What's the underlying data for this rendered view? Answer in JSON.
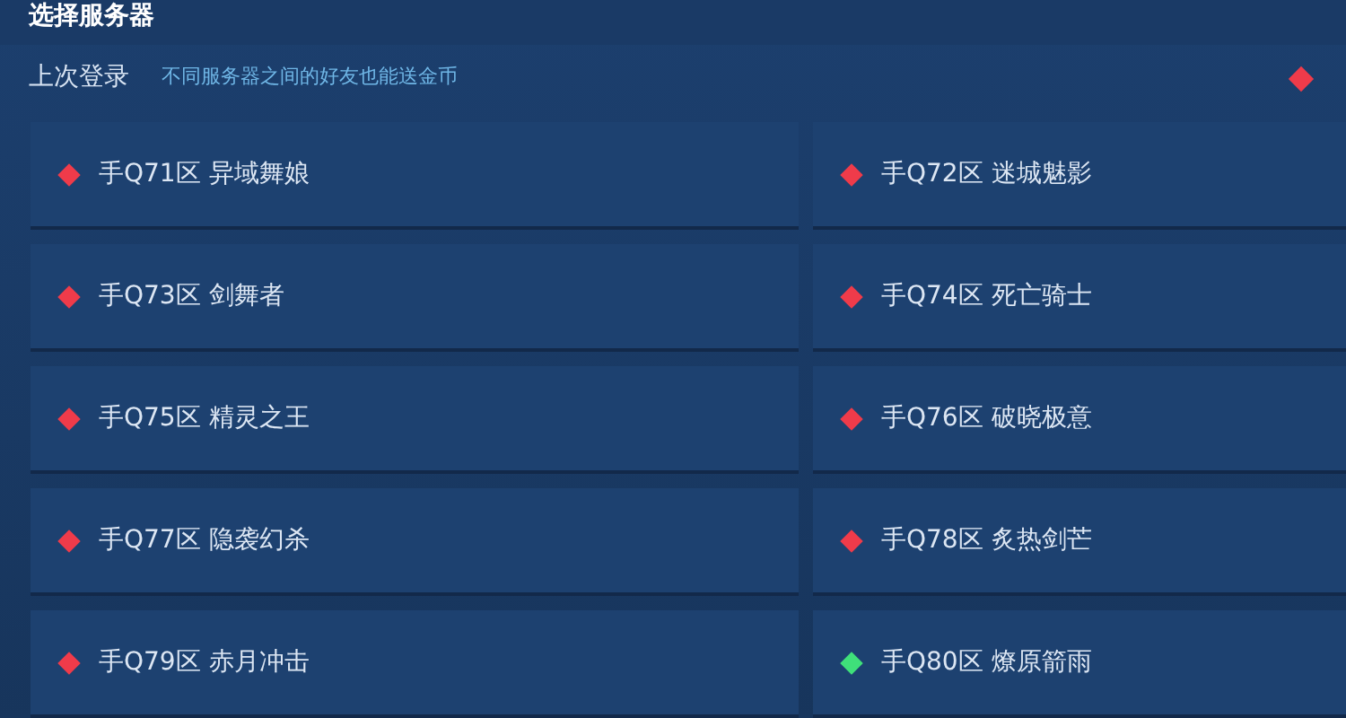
{
  "window": {
    "title": "选择服务器"
  },
  "last_login": {
    "label": "上次登录",
    "hint": "不同服务器之间的好友也能送金币"
  },
  "servers": [
    {
      "name": "手Q71区 异域舞娘",
      "color": "#ef3b4a"
    },
    {
      "name": "手Q72区 迷城魅影",
      "color": "#ef3b4a"
    },
    {
      "name": "手Q73区 剑舞者",
      "color": "#ef3b4a"
    },
    {
      "name": "手Q74区 死亡骑士",
      "color": "#ef3b4a"
    },
    {
      "name": "手Q75区 精灵之王",
      "color": "#ef3b4a"
    },
    {
      "name": "手Q76区 破晓极意",
      "color": "#ef3b4a"
    },
    {
      "name": "手Q77区 隐袭幻杀",
      "color": "#ef3b4a"
    },
    {
      "name": "手Q78区 炙热剑芒",
      "color": "#ef3b4a"
    },
    {
      "name": "手Q79区 赤月冲击",
      "color": "#ef3b4a"
    },
    {
      "name": "手Q80区 燎原箭雨",
      "color": "#3fe07a"
    }
  ]
}
